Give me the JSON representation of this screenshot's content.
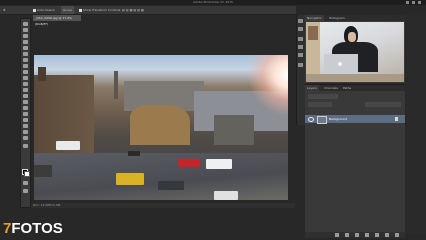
{
  "app": {
    "title": "Adobe Photoshop CC 2015"
  },
  "options_bar": {
    "auto_select_label": "Auto-Select:",
    "auto_select_value": "Group",
    "transform_label": "Show Transform Controls"
  },
  "document": {
    "tab_label": "_DSC_0099.jpg @ 17.9% (RGB/8*)",
    "status_text": "Doc: 12.0M/12.0M"
  },
  "panels": {
    "navigator_tab": "Navigator",
    "histogram_tab": "Histogram",
    "layers_tab": "Layers",
    "channels_tab": "Channels",
    "paths_tab": "Paths",
    "layer_name": "Background"
  },
  "watermark": {
    "digit": "7",
    "text": "FOTOS"
  },
  "colors": {
    "accent": "#e1a02d",
    "selected_layer": "#5c6d83",
    "panel_bg": "#393939"
  }
}
